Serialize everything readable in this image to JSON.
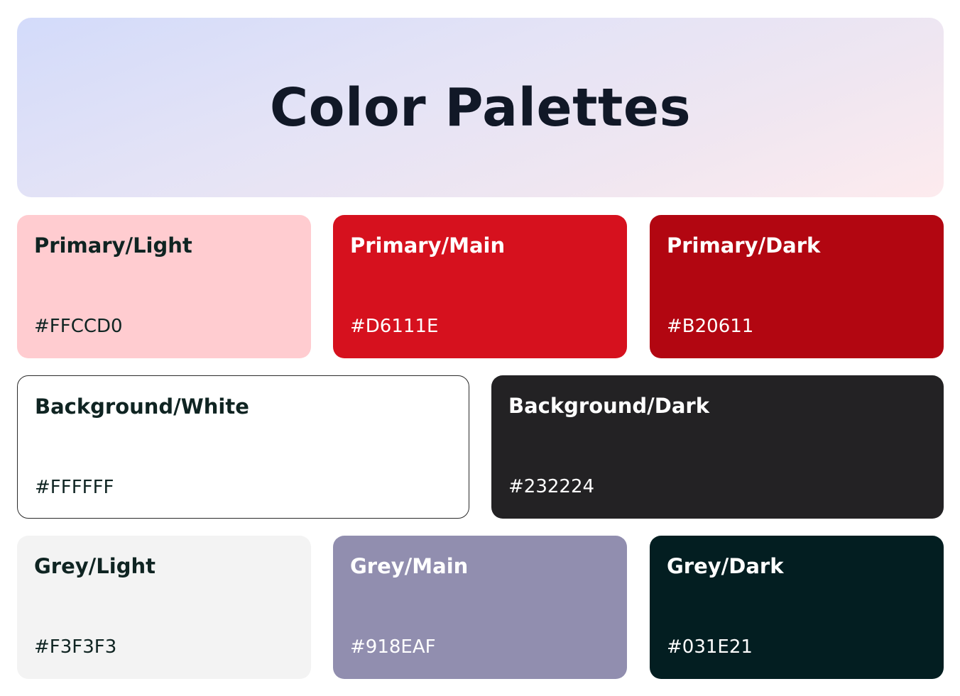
{
  "title": "Color Palettes",
  "palettes": [
    {
      "name": "Primary/Light",
      "hex": "#FFCCD0",
      "color": "#FFCCD0",
      "text": "dark"
    },
    {
      "name": "Primary/Main",
      "hex": "#D6111E",
      "color": "#D6111E",
      "text": "light"
    },
    {
      "name": "Primary/Dark",
      "hex": "#B20611",
      "color": "#B20611",
      "text": "light"
    },
    {
      "name": "Background/White",
      "hex": "#FFFFFF",
      "color": "#FFFFFF",
      "text": "dark"
    },
    {
      "name": "Background/Dark",
      "hex": "#232224",
      "color": "#232224",
      "text": "light"
    },
    {
      "name": "Grey/Light",
      "hex": "#F3F3F3",
      "color": "#F3F3F3",
      "text": "dark"
    },
    {
      "name": "Grey/Main",
      "hex": "#918EAF",
      "color": "#918EAF",
      "text": "light"
    },
    {
      "name": "Grey/Dark",
      "hex": "#031E21",
      "color": "#031E21",
      "text": "light"
    }
  ]
}
